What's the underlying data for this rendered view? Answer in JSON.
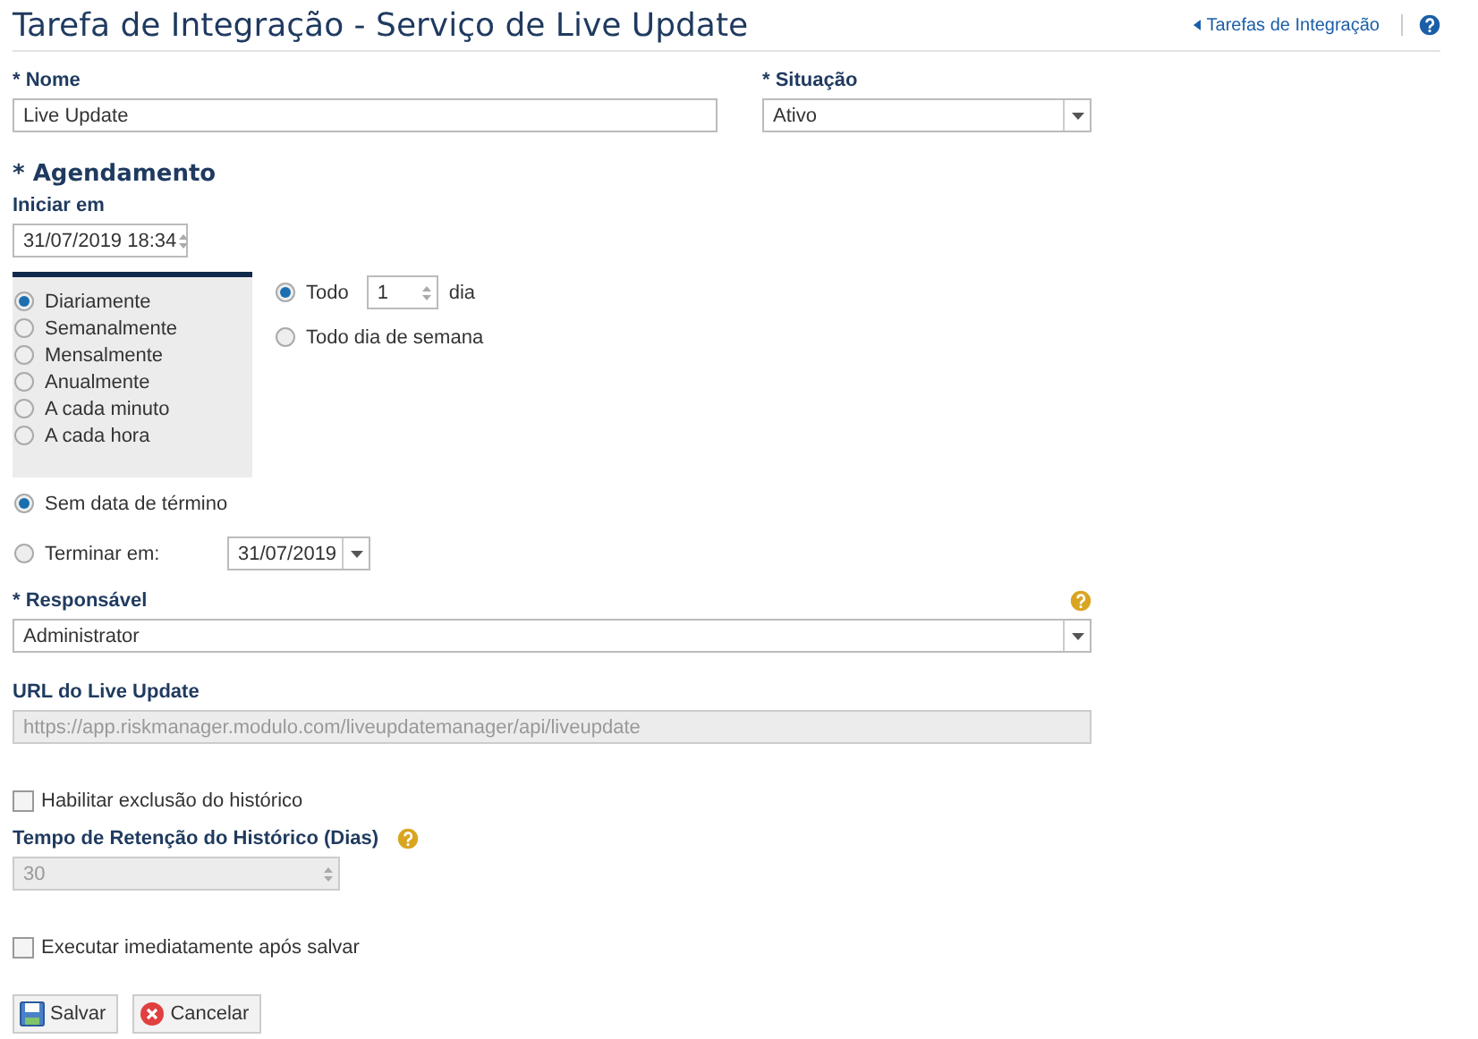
{
  "header": {
    "title": "Tarefa de Integração - Serviço de Live Update",
    "back_link": "Tarefas de Integração"
  },
  "nome": {
    "label": "* Nome",
    "value": "Live Update"
  },
  "situacao": {
    "label": "* Situação",
    "value": "Ativo"
  },
  "agendamento": {
    "heading": "* Agendamento",
    "start_label": "Iniciar em",
    "start_value": "31/07/2019 18:34",
    "frequencies": [
      {
        "label": "Diariamente",
        "selected": true
      },
      {
        "label": "Semanalmente",
        "selected": false
      },
      {
        "label": "Mensalmente",
        "selected": false
      },
      {
        "label": "Anualmente",
        "selected": false
      },
      {
        "label": "A cada minuto",
        "selected": false
      },
      {
        "label": "A cada hora",
        "selected": false
      }
    ],
    "options": [
      {
        "kind": "interval",
        "label": "Todo",
        "value": "1",
        "unit": "dia",
        "selected": true
      },
      {
        "kind": "plain",
        "label": "Todo dia de semana",
        "selected": false
      }
    ],
    "end_options": [
      {
        "kind": "plain",
        "label": "Sem data de término",
        "selected": true
      },
      {
        "kind": "date",
        "label": "Terminar em:",
        "value": "31/07/2019",
        "selected": false
      }
    ]
  },
  "responsavel": {
    "label": "* Responsável",
    "value": "Administrator"
  },
  "url": {
    "label": "URL do Live Update",
    "value": "https://app.riskmanager.modulo.com/liveupdatemanager/api/liveupdate",
    "disabled": true
  },
  "habilitar": {
    "label": "Habilitar exclusão do histórico",
    "checked": false
  },
  "retencao": {
    "label": "Tempo de Retenção do Histórico (Dias)",
    "value": "30",
    "disabled": true
  },
  "executar": {
    "label": "Executar imediatamente após salvar",
    "checked": false
  },
  "buttons": [
    {
      "kind": "save",
      "label": "Salvar"
    },
    {
      "kind": "cancel",
      "label": "Cancelar"
    }
  ]
}
